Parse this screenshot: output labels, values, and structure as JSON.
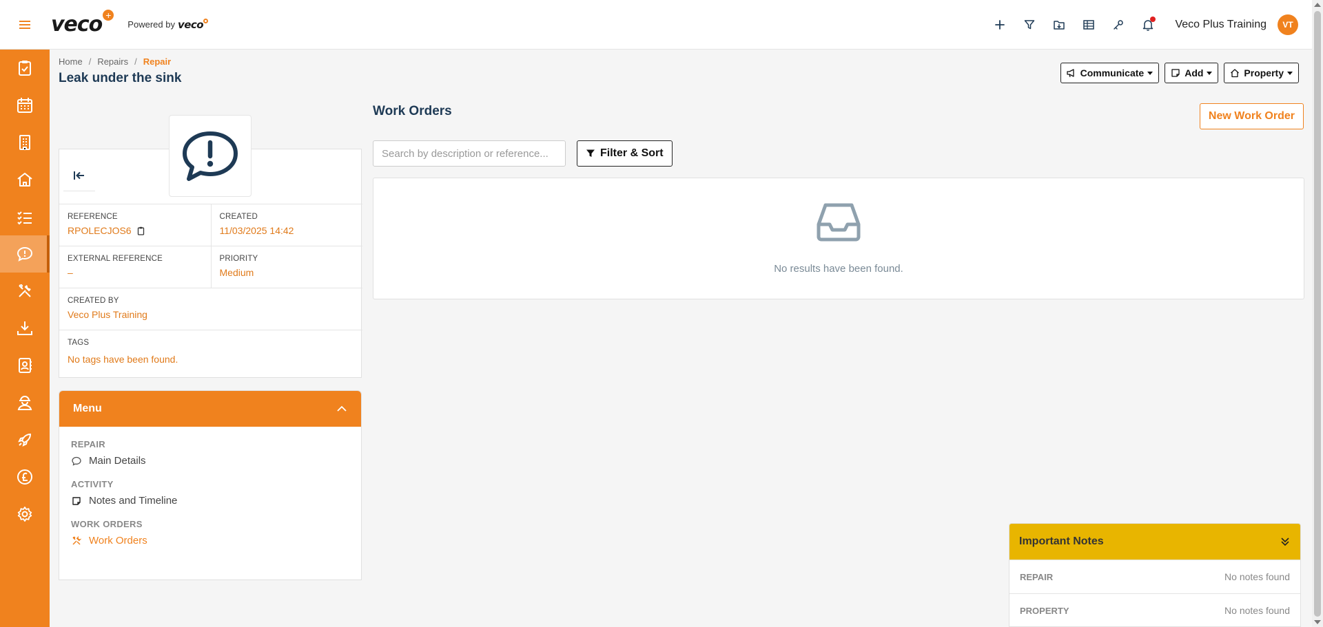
{
  "app": {
    "logo_text": "veco",
    "logo_plus": "+",
    "powered_by": "Powered by",
    "powered_logo": "veco"
  },
  "topbar": {
    "icons": [
      "plus-icon",
      "filter-icon",
      "folder-download-icon",
      "table-icon",
      "key-icon",
      "bell-icon"
    ],
    "user_name": "Veco Plus Training",
    "avatar_initials": "VT"
  },
  "sidebar": {
    "items": [
      {
        "icon": "clipboard-check-icon",
        "active": false
      },
      {
        "icon": "calendar-icon",
        "active": false
      },
      {
        "icon": "building-icon",
        "active": false
      },
      {
        "icon": "house-icon",
        "active": false
      },
      {
        "icon": "checklist-icon",
        "active": false
      },
      {
        "icon": "message-alert-icon",
        "active": true
      },
      {
        "icon": "tools-icon",
        "active": false
      },
      {
        "icon": "download-tray-icon",
        "active": false
      },
      {
        "icon": "contact-book-icon",
        "active": false
      },
      {
        "icon": "worker-icon",
        "active": false
      },
      {
        "icon": "rocket-icon",
        "active": false
      },
      {
        "icon": "pound-icon",
        "active": false
      },
      {
        "icon": "gear-icon",
        "active": false
      }
    ]
  },
  "breadcrumb": {
    "home": "Home",
    "repairs": "Repairs",
    "current": "Repair"
  },
  "page": {
    "title": "Leak under the sink"
  },
  "header_buttons": {
    "communicate": "Communicate",
    "add": "Add",
    "property": "Property"
  },
  "summary": {
    "reference_label": "REFERENCE",
    "reference_value": "RPOLECJOS6",
    "created_label": "CREATED",
    "created_value": "11/03/2025 14:42",
    "external_reference_label": "EXTERNAL REFERENCE",
    "external_reference_value": "–",
    "priority_label": "PRIORITY",
    "priority_value": "Medium",
    "created_by_label": "CREATED BY",
    "created_by_value": "Veco Plus Training",
    "tags_label": "TAGS",
    "tags_value": "No tags have been found."
  },
  "menu": {
    "title": "Menu",
    "sections": [
      {
        "heading": "REPAIR",
        "item": "Main Details"
      },
      {
        "heading": "ACTIVITY",
        "item": "Notes and Timeline"
      },
      {
        "heading": "WORK ORDERS",
        "item": "Work Orders"
      }
    ]
  },
  "work_orders": {
    "title": "Work Orders",
    "new_button": "New Work Order",
    "search_placeholder": "Search by description or reference...",
    "filter_button": "Filter & Sort",
    "empty_text": "No results have been found."
  },
  "important_notes": {
    "title": "Important Notes",
    "rows": [
      {
        "label": "REPAIR",
        "value": "No notes found"
      },
      {
        "label": "PROPERTY",
        "value": "No notes found"
      }
    ]
  },
  "colors": {
    "brand": "#f0821e",
    "title": "#1e3a55",
    "notes_header": "#e8b500"
  }
}
